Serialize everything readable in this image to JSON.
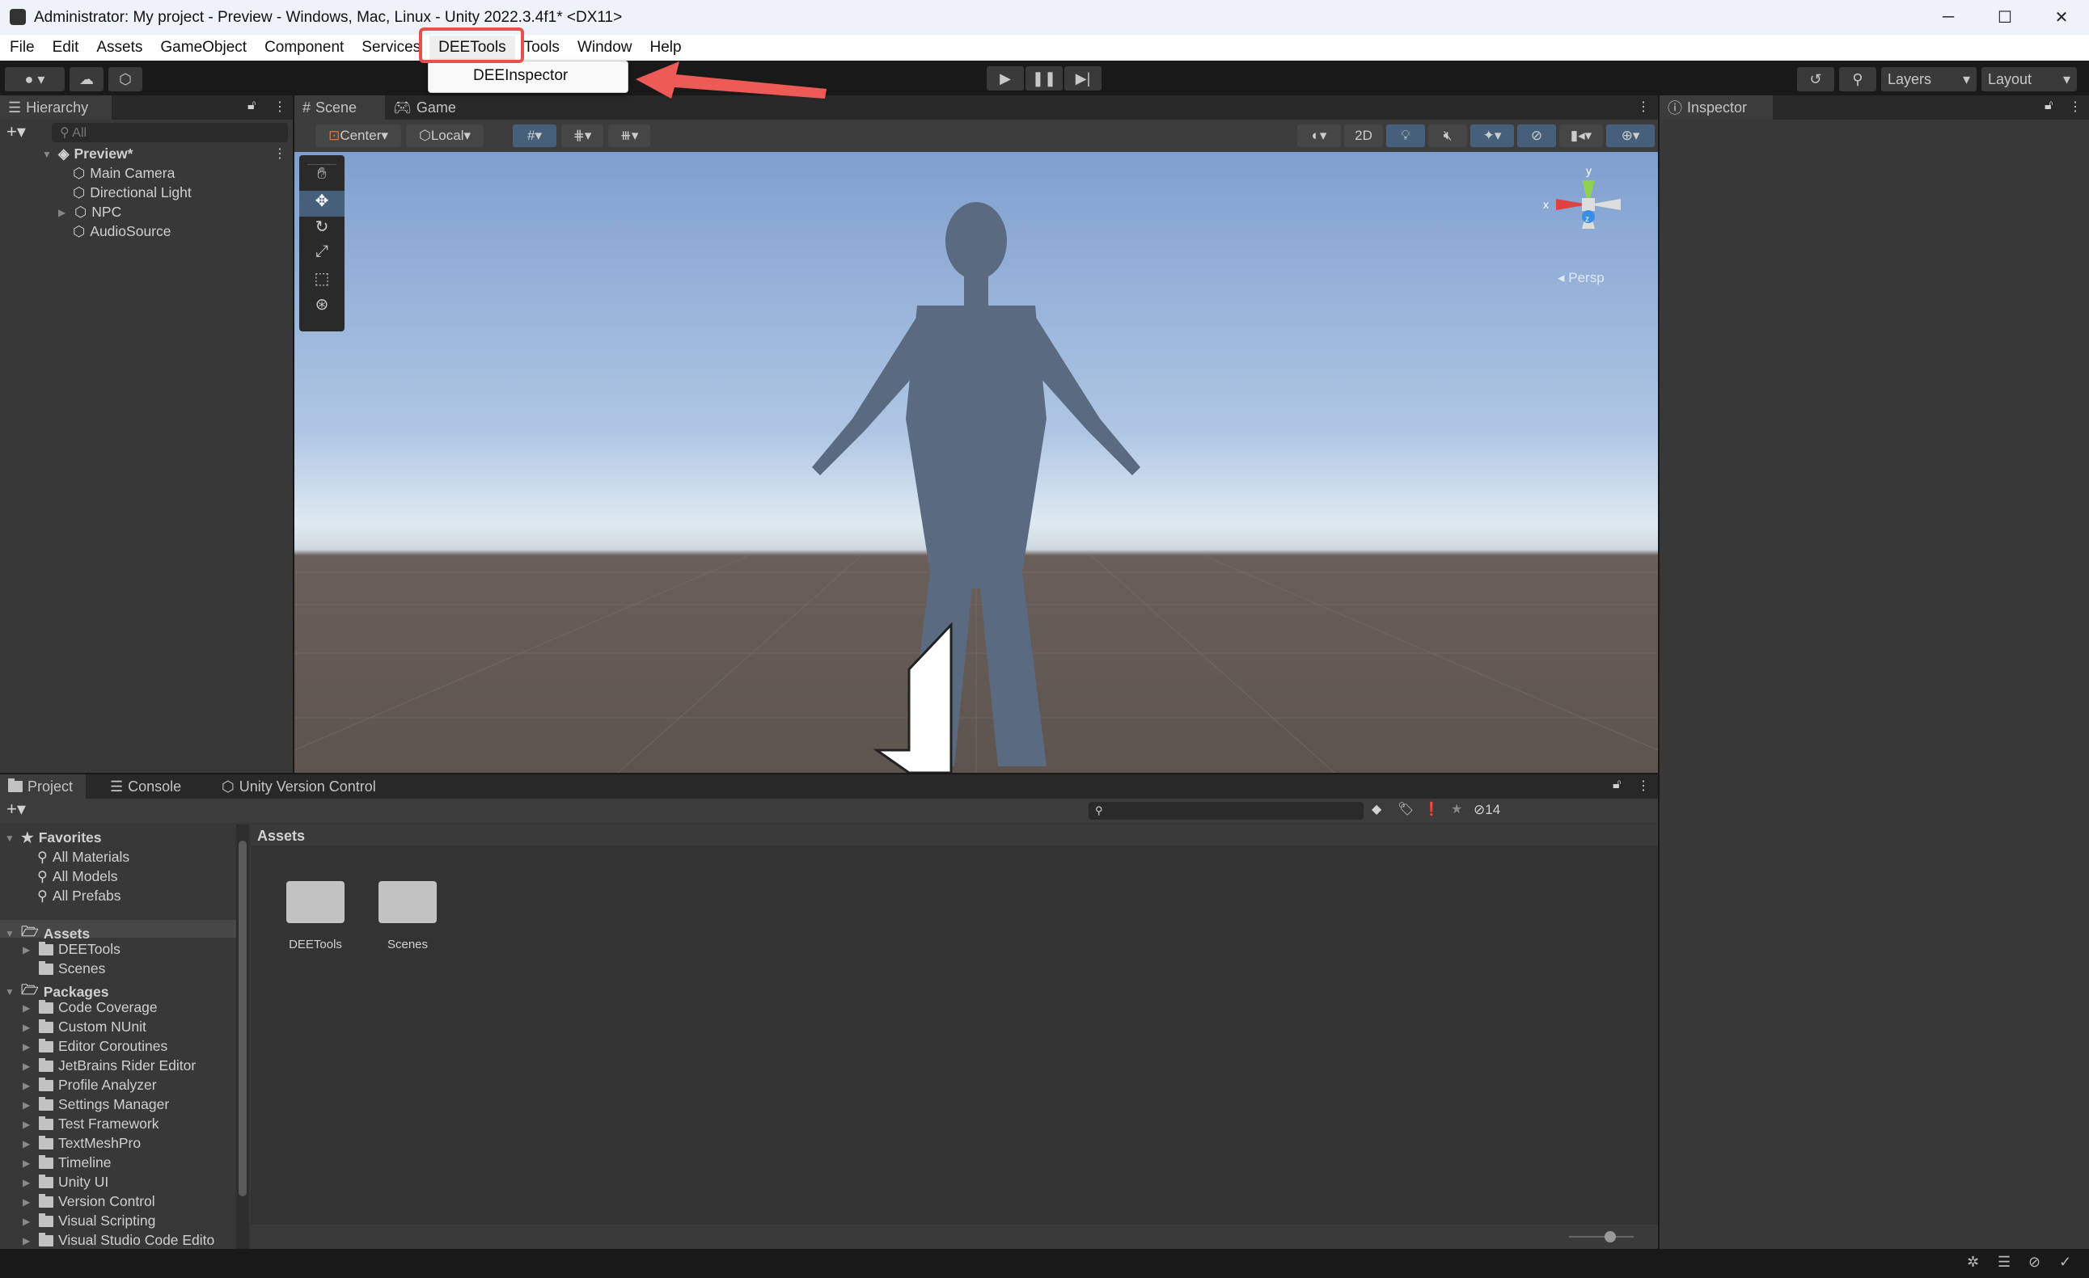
{
  "window": {
    "title": "Administrator: My project - Preview - Windows, Mac, Linux - Unity 2022.3.4f1* <DX11>",
    "controls": [
      "minimize",
      "maximize",
      "close"
    ]
  },
  "menubar": {
    "items": [
      "File",
      "Edit",
      "Assets",
      "GameObject",
      "Component",
      "Services",
      "DEETools",
      "Tools",
      "Window",
      "Help"
    ],
    "highlighted": "DEETools"
  },
  "dropdown": {
    "items": [
      "DEEInspector"
    ]
  },
  "annotation": {
    "highlight_color": "#e8504b",
    "arrow_color": "#ee5a55"
  },
  "toolbar": {
    "layers_label": "Layers",
    "layout_label": "Layout"
  },
  "hierarchy": {
    "tab": "Hierarchy",
    "search_placeholder": "All",
    "scene": "Preview*",
    "items": [
      {
        "label": "Main Camera",
        "expandable": false
      },
      {
        "label": "Directional Light",
        "expandable": false
      },
      {
        "label": "NPC",
        "expandable": true
      },
      {
        "label": "AudioSource",
        "expandable": false
      }
    ]
  },
  "scene": {
    "tabs": [
      "Scene",
      "Game"
    ],
    "active_tab": "Scene",
    "pivot": "Center",
    "space": "Local",
    "mode_2d": "2D",
    "persp_label": "Persp",
    "gizmo": {
      "x": "x",
      "y": "y",
      "z": "z"
    }
  },
  "inspector": {
    "tab": "Inspector"
  },
  "bottom": {
    "tabs": [
      "Project",
      "Console",
      "Unity Version Control"
    ],
    "active_tab": "Project",
    "hidden_count": "14",
    "favorites": {
      "label": "Favorites",
      "items": [
        "All Materials",
        "All Models",
        "All Prefabs"
      ]
    },
    "assets_tree": {
      "label": "Assets",
      "items": [
        {
          "label": "DEETools",
          "expandable": true
        },
        {
          "label": "Scenes",
          "expandable": false
        }
      ]
    },
    "packages": {
      "label": "Packages",
      "items": [
        "Code Coverage",
        "Custom NUnit",
        "Editor Coroutines",
        "JetBrains Rider Editor",
        "Profile Analyzer",
        "Settings Manager",
        "Test Framework",
        "TextMeshPro",
        "Timeline",
        "Unity UI",
        "Version Control",
        "Visual Scripting",
        "Visual Studio Code Edito"
      ]
    },
    "breadcrumb": "Assets",
    "grid_items": [
      "DEETools",
      "Scenes"
    ]
  }
}
